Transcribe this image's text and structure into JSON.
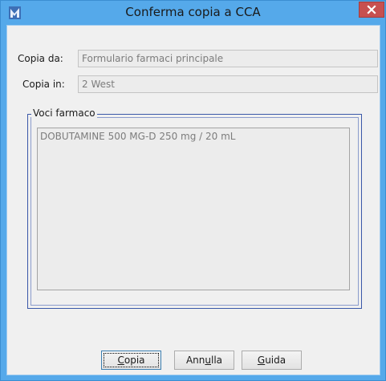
{
  "window": {
    "title": "Conferma copia a CCA",
    "icon": "app-logo-icon",
    "close_icon": "close-icon",
    "colors": {
      "titlebar": "#55a9ea",
      "close": "#c75050",
      "group_border": "#3a58a8"
    }
  },
  "form": {
    "copy_from": {
      "label": "Copia da:",
      "value": "Formulario farmaci principale"
    },
    "copy_to": {
      "label": "Copia in:",
      "value": "2 West"
    }
  },
  "drug_items": {
    "legend": "Voci farmaco",
    "items": [
      "DOBUTAMINE 500 MG-D 250 mg / 20 mL"
    ]
  },
  "buttons": {
    "copy": {
      "pre": "",
      "mnemonic": "C",
      "post": "opia"
    },
    "cancel": {
      "pre": "Ann",
      "mnemonic": "u",
      "post": "lla"
    },
    "help": {
      "pre": "",
      "mnemonic": "G",
      "post": "uida"
    }
  }
}
